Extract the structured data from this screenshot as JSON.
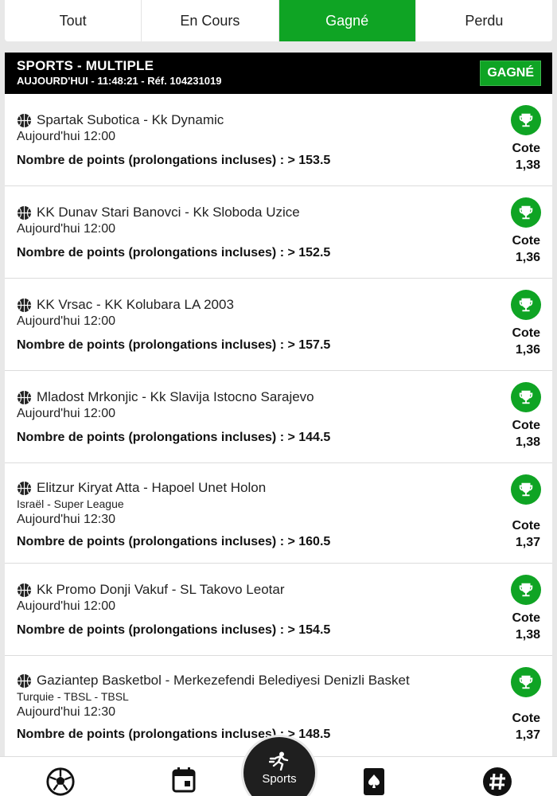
{
  "tabs": [
    {
      "label": "Tout"
    },
    {
      "label": "En Cours"
    },
    {
      "label": "Gagné"
    },
    {
      "label": "Perdu"
    }
  ],
  "active_tab": "Gagné",
  "bet": {
    "title": "SPORTS - MULTIPLE",
    "subtitle": "AUJOURD'HUI - 11:48:21 - Réf. 104231019",
    "status": "GAGNÉ"
  },
  "matches": [
    {
      "name": "Spartak Subotica - Kk Dynamic",
      "league": "",
      "time": "Aujourd'hui 12:00",
      "market": "Nombre de points (prolongations incluses) : > 153.5",
      "cote_label": "Cote",
      "cote": "1,38"
    },
    {
      "name": "KK Dunav Stari Banovci - Kk Sloboda Uzice",
      "league": "",
      "time": "Aujourd'hui 12:00",
      "market": "Nombre de points (prolongations incluses) : > 152.5",
      "cote_label": "Cote",
      "cote": "1,36"
    },
    {
      "name": "KK Vrsac - KK Kolubara LA 2003",
      "league": "",
      "time": "Aujourd'hui 12:00",
      "market": "Nombre de points (prolongations incluses) : > 157.5",
      "cote_label": "Cote",
      "cote": "1,36"
    },
    {
      "name": "Mladost Mrkonjic - Kk Slavija Istocno Sarajevo",
      "league": "",
      "time": "Aujourd'hui 12:00",
      "market": "Nombre de points (prolongations incluses) : > 144.5",
      "cote_label": "Cote",
      "cote": "1,38"
    },
    {
      "name": "Elitzur Kiryat Atta - Hapoel Unet Holon",
      "league": "Israël  -  Super League",
      "time": "Aujourd'hui 12:30",
      "market": "Nombre de points (prolongations incluses) : > 160.5",
      "cote_label": "Cote",
      "cote": "1,37"
    },
    {
      "name": "Kk Promo Donji Vakuf - SL Takovo Leotar",
      "league": "",
      "time": "Aujourd'hui 12:00",
      "market": "Nombre de points (prolongations incluses) : > 154.5",
      "cote_label": "Cote",
      "cote": "1,38"
    },
    {
      "name": "Gaziantep Basketbol - Merkezefendi Belediyesi Denizli Basket",
      "league": "Turquie  -  TBSL  -  TBSL",
      "time": "Aujourd'hui 12:30",
      "market": "Nombre de points (prolongations incluses) : > 148.5",
      "cote_label": "Cote",
      "cote": "1,37"
    }
  ],
  "bottom_nav": {
    "sports_label": "Sports",
    "items": [
      "football-icon",
      "calendar-icon",
      "sports-icon",
      "casino-card-icon",
      "hashtag-icon"
    ]
  },
  "colors": {
    "accent": "#0fa424",
    "header_bg": "#000000",
    "fab_bg": "#1f1f1f"
  }
}
